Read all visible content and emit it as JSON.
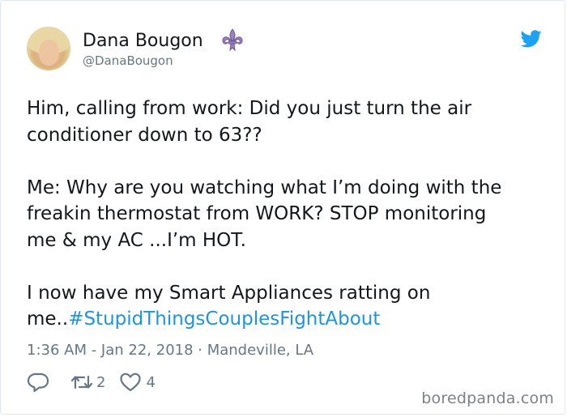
{
  "author": {
    "display_name": "Dana Bougon",
    "handle": "@DanaBougon",
    "badge_icon": "fleur-de-lis-icon",
    "avatar": "profile-photo"
  },
  "tweet": {
    "text_part1": "Him, calling from work:  Did you just turn the air\nconditioner down to 63??\n\nMe: Why are you watching what I’m doing with the\nfreakin thermostat from WORK? STOP monitoring\nme & my AC ...I’m HOT.\n\nI now have my Smart Appliances ratting on\nme..",
    "hashtag": "#StupidThingsCouplesFightAbout",
    "timestamp": "1:36 AM - Jan 22, 2018 · Mandeville, LA"
  },
  "actions": {
    "retweets": "2",
    "likes": "4"
  },
  "icons": {
    "platform": "twitter-bird-icon",
    "reply": "reply-icon",
    "retweet": "retweet-icon",
    "like": "heart-icon"
  },
  "colors": {
    "brand_blue": "#1da1f2",
    "hashtag": "#1b95e0",
    "secondary_text": "#657786",
    "badge_purple": "#9a7fc1"
  },
  "watermark": "boredpanda.com"
}
